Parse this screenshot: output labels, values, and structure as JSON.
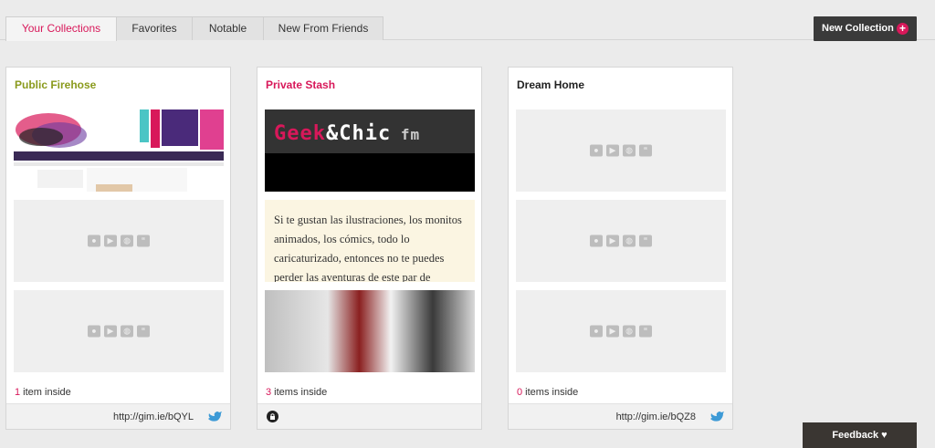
{
  "tabs": [
    {
      "label": "Your Collections"
    },
    {
      "label": "Favorites"
    },
    {
      "label": "Notable"
    },
    {
      "label": "New From Friends"
    }
  ],
  "new_collection": {
    "label": "New Collection",
    "icon": "plus-icon"
  },
  "collections": [
    {
      "title": "Public Firehose",
      "title_color": "#8a9a1c",
      "count": "1",
      "count_suffix": " item inside",
      "url": "http://gim.ie/bQYL"
    },
    {
      "title": "Private Stash",
      "title_color": "#d8185a",
      "count": "3",
      "count_suffix": " items inside",
      "banner_logo_a": "Geek",
      "banner_logo_b": "&Chic",
      "banner_logo_c": " fm",
      "text_card": "Si te gustan las ilustraciones, los monitos animados, los cómics, todo lo caricaturizado, entonces no te puedes perder las aventuras de este par de",
      "footer_icon": "lock-icon"
    },
    {
      "title": "Dream Home",
      "title_color": "#222222",
      "count": "0",
      "count_suffix": " items inside",
      "url": "http://gim.ie/bQZ8"
    }
  ],
  "placeholder_icons": [
    "camera-icon",
    "video-icon",
    "globe-icon",
    "quote-icon"
  ],
  "feedback": {
    "label": "Feedback ♥"
  },
  "accent_color": "#d8185a"
}
